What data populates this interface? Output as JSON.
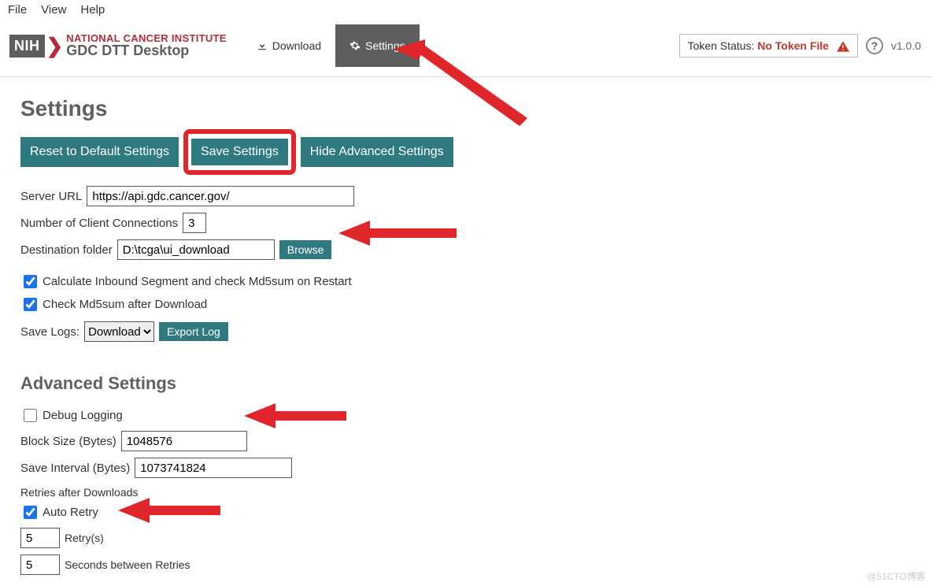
{
  "menu": {
    "file": "File",
    "view": "View",
    "help": "Help"
  },
  "logo": {
    "badge": "NIH",
    "line1": "NATIONAL CANCER INSTITUTE",
    "line2": "GDC DTT Desktop"
  },
  "nav": {
    "download": "Download",
    "settings": "Settings"
  },
  "header_right": {
    "token_label": "Token Status: ",
    "token_value": "No Token File",
    "help": "?",
    "version": "v1.0.0"
  },
  "page": {
    "title": "Settings",
    "reset_btn": "Reset to Default Settings",
    "save_btn": "Save Settings",
    "hide_btn": "Hide Advanced Settings",
    "server_url_label": "Server URL",
    "server_url_value": "https://api.gdc.cancer.gov/",
    "client_conn_label": "Number of Client Connections",
    "client_conn_value": "3",
    "dest_label": "Destination folder",
    "dest_value": "D:\\tcga\\ui_download",
    "browse_btn": "Browse",
    "chk1": "Calculate Inbound Segment and check Md5sum on Restart",
    "chk2": "Check Md5sum after Download",
    "save_logs_label": "Save Logs:",
    "save_logs_option": "Download",
    "export_log_btn": "Export Log"
  },
  "advanced": {
    "title": "Advanced Settings",
    "debug_label": "Debug Logging",
    "block_label": "Block Size (Bytes)",
    "block_value": "1048576",
    "interval_label": "Save Interval (Bytes)",
    "interval_value": "1073741824",
    "retries_label": "Retries after Downloads",
    "auto_retry_label": "Auto Retry",
    "retry_count": "5",
    "retry_unit": "Retry(s)",
    "retry_seconds": "5",
    "retry_seconds_label": "Seconds between Retries"
  },
  "watermark": "@51CTO博客"
}
